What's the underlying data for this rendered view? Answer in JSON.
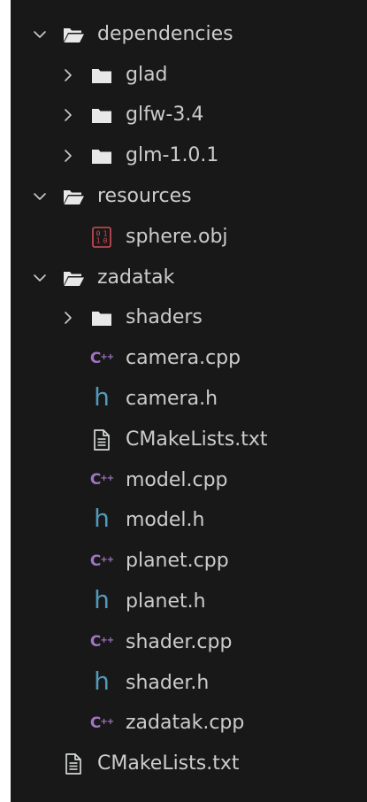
{
  "explorer": {
    "colors": {
      "background": "#181818",
      "text": "#cccccc",
      "folder": "#e8e8e8",
      "cpp_icon": "#a074c4",
      "header_icon": "#519aba",
      "binary_icon": "#d24d57",
      "text_icon": "#d4d7d6"
    },
    "items": [
      {
        "label": "dependencies",
        "type": "folder",
        "expanded": true,
        "depth": 0,
        "icon": "folder-open-icon"
      },
      {
        "label": "glad",
        "type": "folder",
        "expanded": false,
        "depth": 1,
        "icon": "folder-icon"
      },
      {
        "label": "glfw-3.4",
        "type": "folder",
        "expanded": false,
        "depth": 1,
        "icon": "folder-icon"
      },
      {
        "label": "glm-1.0.1",
        "type": "folder",
        "expanded": false,
        "depth": 1,
        "icon": "folder-icon"
      },
      {
        "label": "resources",
        "type": "folder",
        "expanded": true,
        "depth": 0,
        "icon": "folder-open-icon"
      },
      {
        "label": "sphere.obj",
        "type": "file",
        "depth": 1,
        "icon": "binary-file-icon"
      },
      {
        "label": "zadatak",
        "type": "folder",
        "expanded": true,
        "depth": 0,
        "icon": "folder-open-icon"
      },
      {
        "label": "shaders",
        "type": "folder",
        "expanded": false,
        "depth": 1,
        "icon": "folder-icon"
      },
      {
        "label": "camera.cpp",
        "type": "file",
        "depth": 1,
        "icon": "cpp-file-icon"
      },
      {
        "label": "camera.h",
        "type": "file",
        "depth": 1,
        "icon": "header-file-icon"
      },
      {
        "label": "CMakeLists.txt",
        "type": "file",
        "depth": 1,
        "icon": "text-file-icon"
      },
      {
        "label": "model.cpp",
        "type": "file",
        "depth": 1,
        "icon": "cpp-file-icon"
      },
      {
        "label": "model.h",
        "type": "file",
        "depth": 1,
        "icon": "header-file-icon"
      },
      {
        "label": "planet.cpp",
        "type": "file",
        "depth": 1,
        "icon": "cpp-file-icon"
      },
      {
        "label": "planet.h",
        "type": "file",
        "depth": 1,
        "icon": "header-file-icon"
      },
      {
        "label": "shader.cpp",
        "type": "file",
        "depth": 1,
        "icon": "cpp-file-icon"
      },
      {
        "label": "shader.h",
        "type": "file",
        "depth": 1,
        "icon": "header-file-icon"
      },
      {
        "label": "zadatak.cpp",
        "type": "file",
        "depth": 1,
        "icon": "cpp-file-icon"
      },
      {
        "label": "CMakeLists.txt",
        "type": "file",
        "depth": 0,
        "icon": "text-file-icon"
      }
    ]
  }
}
